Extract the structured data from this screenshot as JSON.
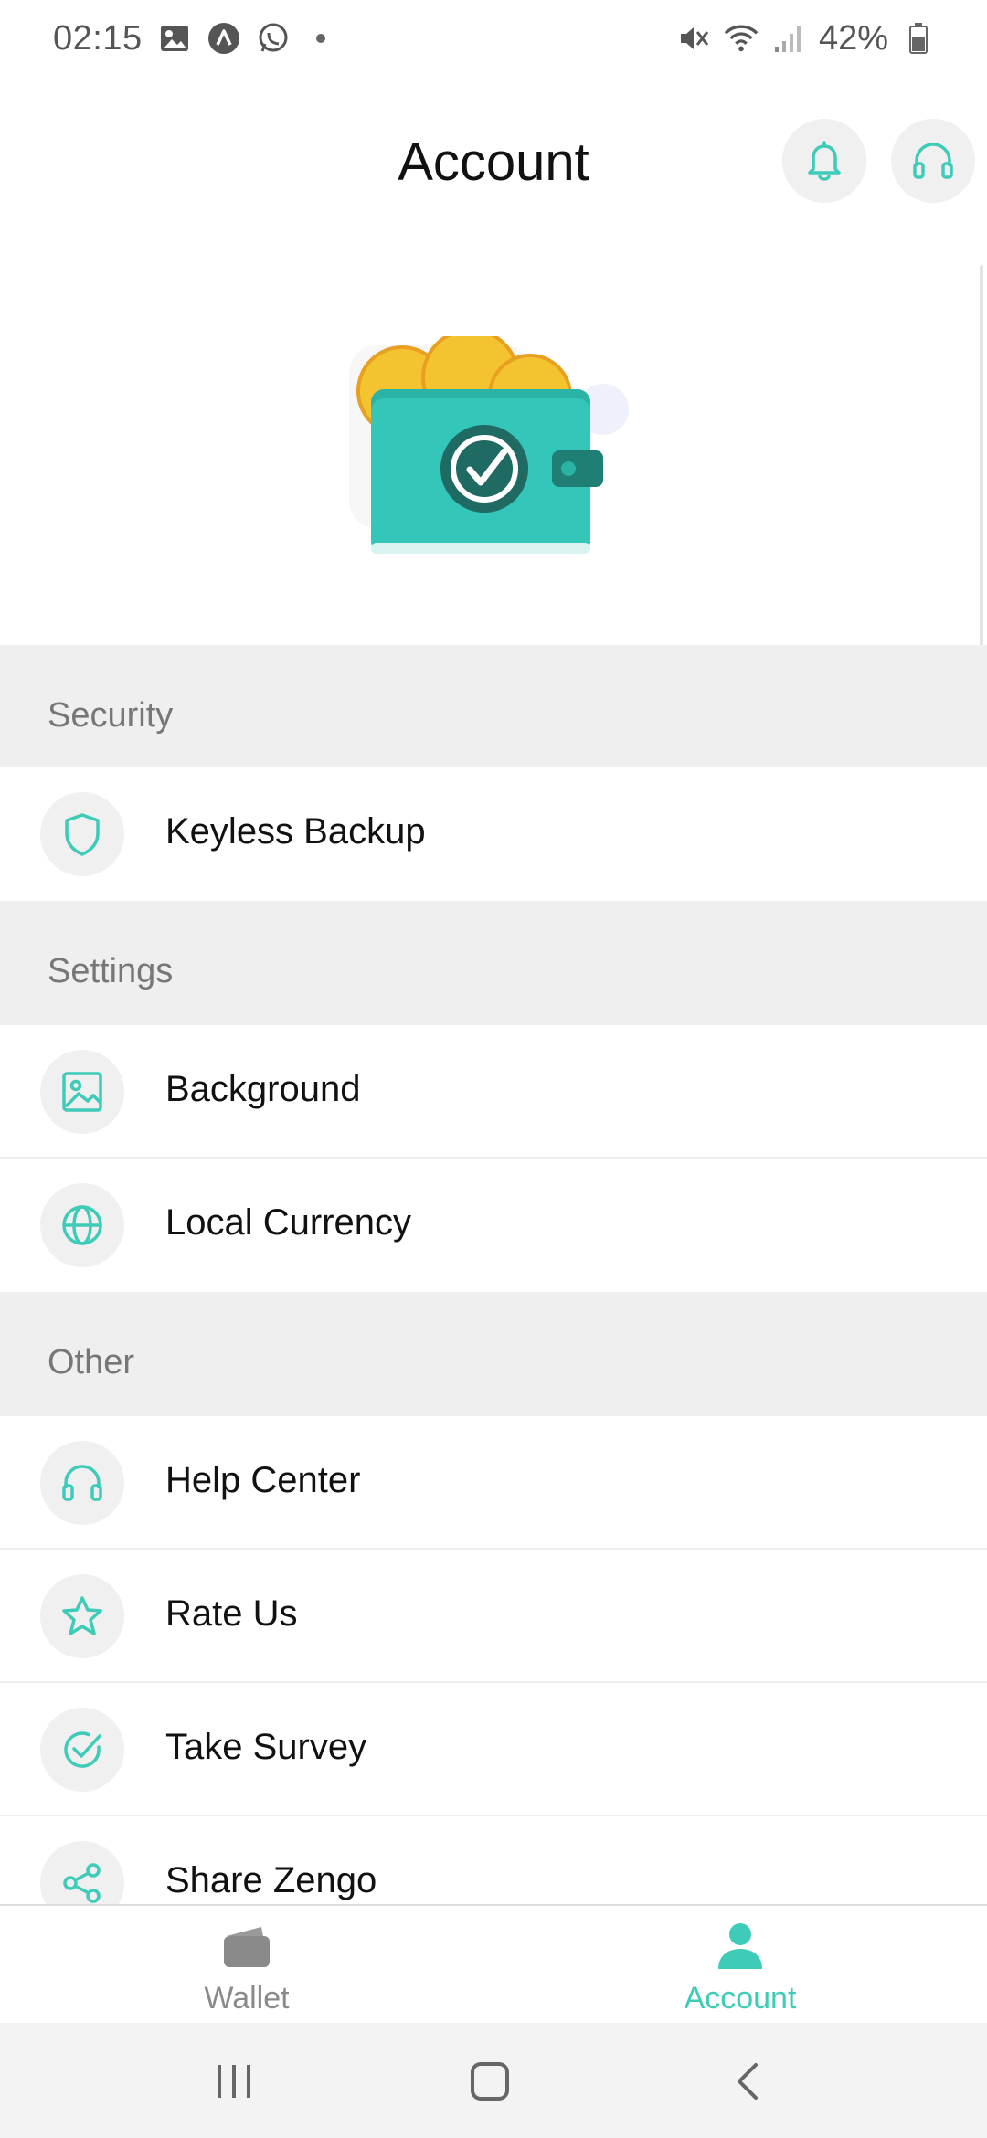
{
  "status_bar": {
    "time": "02:15",
    "battery": "42%",
    "left_icons": [
      "image-icon",
      "arch-app-icon",
      "whatsapp-icon",
      "dot-icon"
    ],
    "right_icons": [
      "mute-icon",
      "wifi-icon",
      "signal-icon",
      "battery-icon"
    ]
  },
  "header": {
    "title": "Account",
    "buttons": [
      "bell-icon",
      "headphones-icon"
    ]
  },
  "colors": {
    "accent": "#3ecbb7",
    "section_bg": "#efefef",
    "icon_bg": "#f0f0f0",
    "wallet_teal": "#34c6b8",
    "coin_gold": "#f4c430"
  },
  "sections": {
    "security": {
      "title": "Security",
      "items": [
        {
          "label": "Keyless Backup",
          "icon": "shield-icon"
        }
      ]
    },
    "settings": {
      "title": "Settings",
      "items": [
        {
          "label": "Background",
          "icon": "image-icon"
        },
        {
          "label": "Local Currency",
          "icon": "globe-icon"
        }
      ]
    },
    "other": {
      "title": "Other",
      "items": [
        {
          "label": "Help Center",
          "icon": "headphones-icon"
        },
        {
          "label": "Rate Us",
          "icon": "star-icon"
        },
        {
          "label": "Take Survey",
          "icon": "check-circle-icon"
        },
        {
          "label": "Share Zengo",
          "icon": "share-icon"
        }
      ]
    }
  },
  "bottom_nav": {
    "items": [
      {
        "label": "Wallet",
        "icon": "wallet-icon",
        "active": false
      },
      {
        "label": "Account",
        "icon": "user-icon",
        "active": true
      }
    ]
  },
  "system_nav": [
    "recents-icon",
    "home-icon",
    "back-icon"
  ]
}
